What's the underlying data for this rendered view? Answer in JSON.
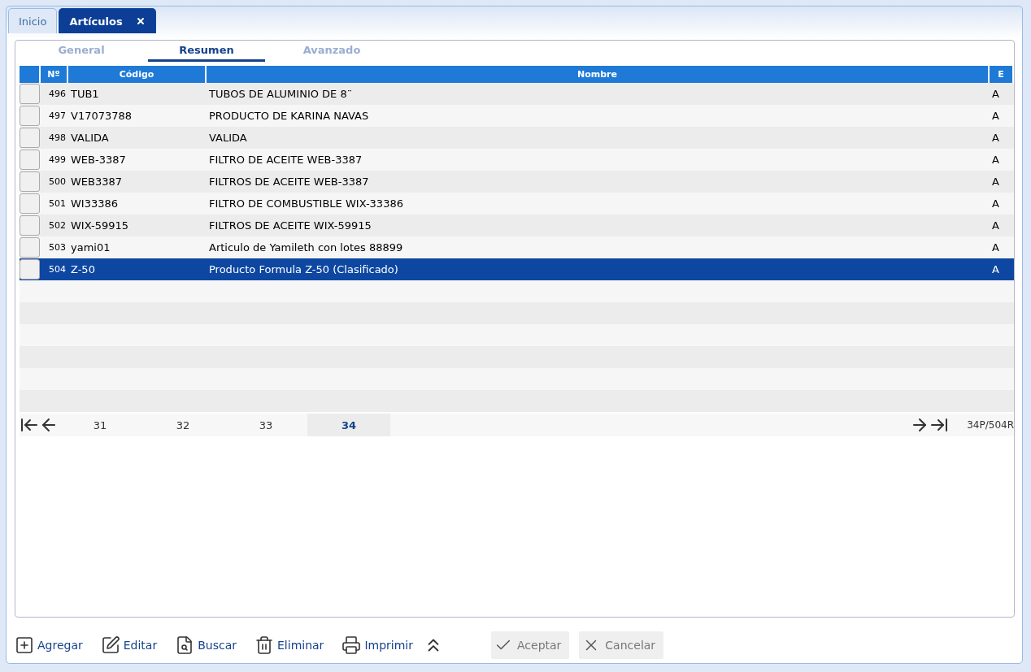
{
  "tabs": [
    {
      "label": "Inicio",
      "selected": false,
      "closable": false
    },
    {
      "label": "Artículos",
      "selected": true,
      "closable": true
    }
  ],
  "subtabs": [
    {
      "label": "General",
      "selected": false
    },
    {
      "label": "Resumen",
      "selected": true
    },
    {
      "label": "Avanzado",
      "selected": false
    }
  ],
  "table": {
    "columns": [
      "Nº",
      "Código",
      "Nombre",
      "E"
    ],
    "rows": [
      {
        "no": "496",
        "code": "TUB1",
        "name": "TUBOS DE ALUMINIO DE 8¨",
        "e": "A",
        "selected": false
      },
      {
        "no": "497",
        "code": "V17073788",
        "name": "PRODUCTO DE KARINA NAVAS",
        "e": "A",
        "selected": false
      },
      {
        "no": "498",
        "code": "VALIDA",
        "name": "VALIDA",
        "e": "A",
        "selected": false
      },
      {
        "no": "499",
        "code": "WEB-3387",
        "name": "FILTRO DE ACEITE WEB-3387",
        "e": "A",
        "selected": false
      },
      {
        "no": "500",
        "code": "WEB3387",
        "name": "FILTROS DE ACEITE WEB-3387",
        "e": "A",
        "selected": false
      },
      {
        "no": "501",
        "code": "WI33386",
        "name": "FILTRO DE COMBUSTIBLE WIX-33386",
        "e": "A",
        "selected": false
      },
      {
        "no": "502",
        "code": "WIX-59915",
        "name": "FILTROS DE ACEITE WIX-59915",
        "e": "A",
        "selected": false
      },
      {
        "no": "503",
        "code": "yami01",
        "name": "Articulo de Yamileth con lotes 88899",
        "e": "A",
        "selected": false
      },
      {
        "no": "504",
        "code": "Z-50",
        "name": "Producto Formula Z-50 (Clasificado)",
        "e": "A",
        "selected": true
      }
    ]
  },
  "pager": {
    "pages": [
      {
        "label": "31",
        "selected": false
      },
      {
        "label": "32",
        "selected": false
      },
      {
        "label": "33",
        "selected": false
      },
      {
        "label": "34",
        "selected": true
      }
    ],
    "summary": "34P/504R"
  },
  "actions": [
    {
      "kind": "add",
      "label": "Agregar"
    },
    {
      "kind": "edit",
      "label": "Editar"
    },
    {
      "kind": "search",
      "label": "Buscar"
    },
    {
      "kind": "delete",
      "label": "Eliminar"
    },
    {
      "kind": "print",
      "label": "Imprimir"
    }
  ],
  "buttons": [
    {
      "kind": "accept",
      "label": "Aceptar",
      "disabled": true
    },
    {
      "kind": "cancel",
      "label": "Cancelar",
      "disabled": true
    }
  ]
}
